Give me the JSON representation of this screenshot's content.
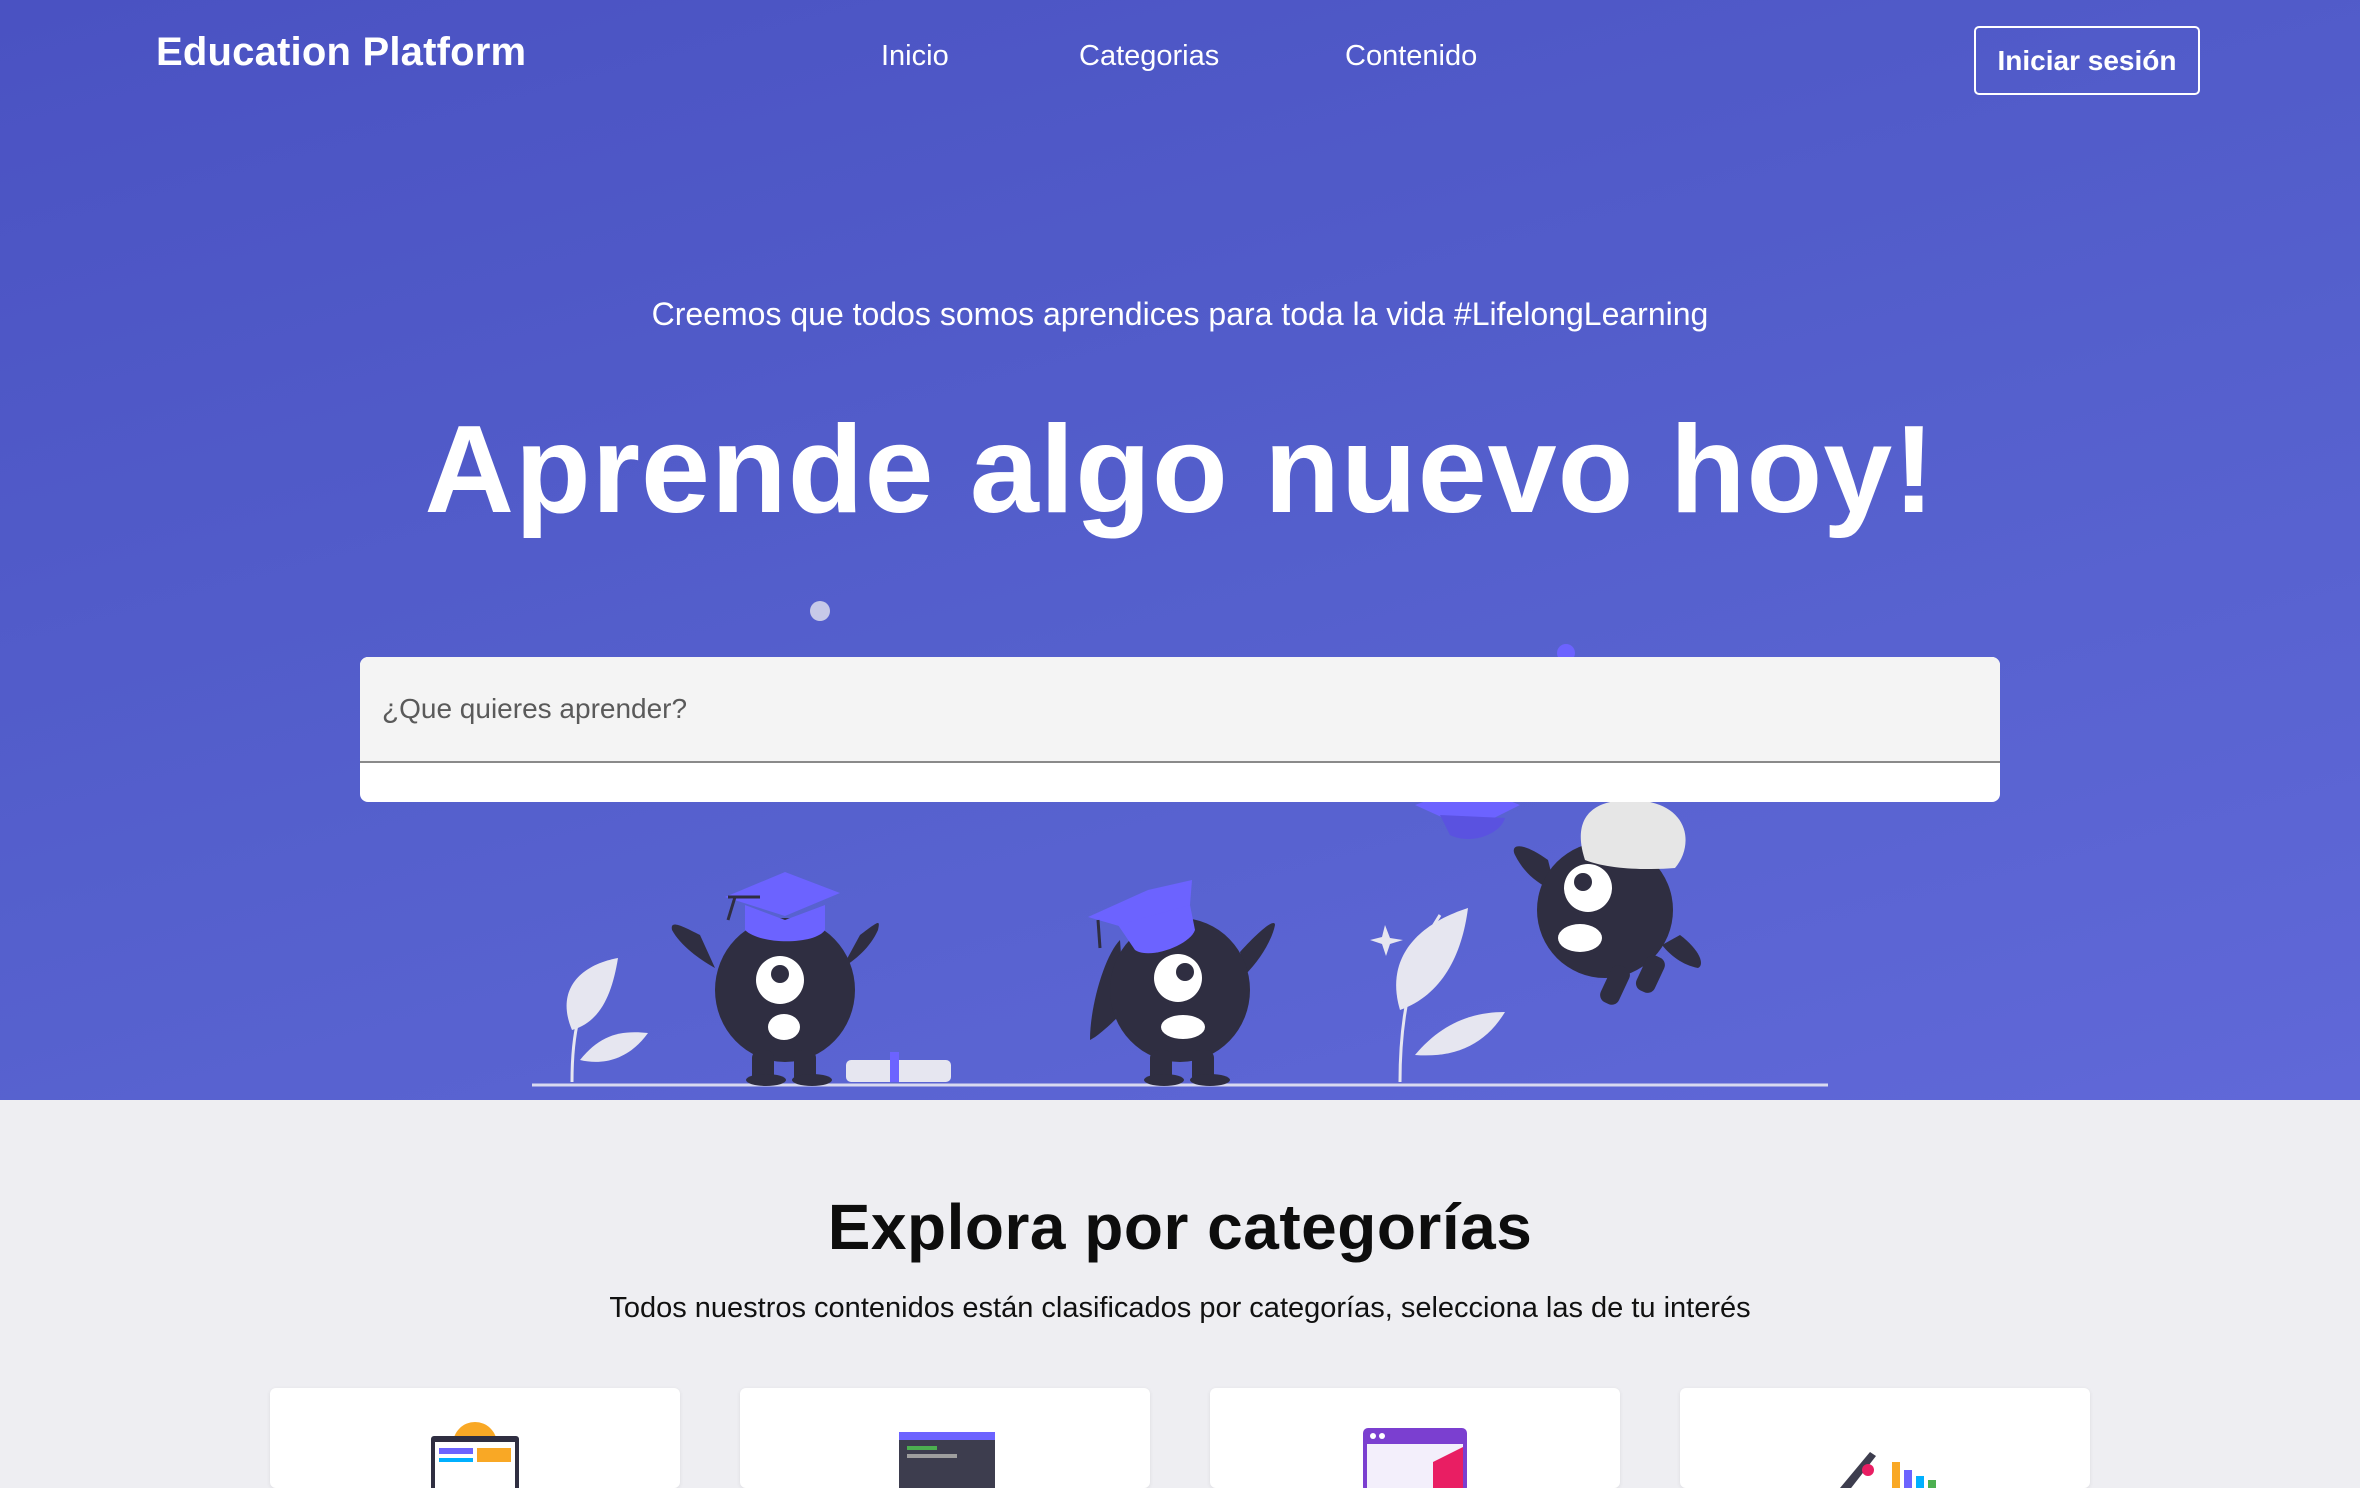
{
  "navbar": {
    "brand": "Education Platform",
    "links": [
      {
        "label": "Inicio"
      },
      {
        "label": "Categorias"
      },
      {
        "label": "Contenido"
      }
    ],
    "login_label": "Iniciar sesión"
  },
  "hero": {
    "tagline": "Creemos que todos somos aprendices para toda la vida #LifelongLearning",
    "headline": "Aprende algo nuevo hoy!",
    "search": {
      "placeholder": "¿Que quieres aprender?",
      "value": ""
    }
  },
  "categories": {
    "title": "Explora por categorías",
    "subtitle": "Todos nuestros contenidos están clasificados por categorías, selecciona las de tu interés",
    "cards": [
      {
        "icon": "web-design-icon"
      },
      {
        "icon": "code-editor-icon"
      },
      {
        "icon": "browser-window-icon"
      },
      {
        "icon": "analytics-chart-icon"
      }
    ]
  },
  "colors": {
    "hero_background": "#5058c8",
    "accent_purple": "#6c63ff",
    "character_dark": "#2f2e41",
    "section_background": "#eeeef2"
  }
}
